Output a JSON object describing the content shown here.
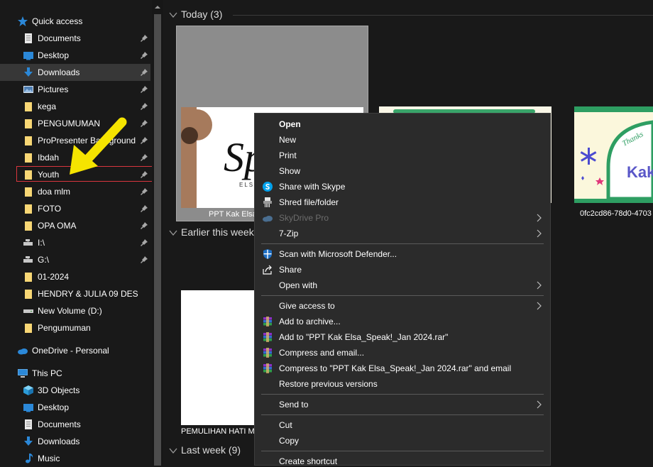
{
  "sidebar": {
    "quick_access": "Quick access",
    "items": [
      {
        "label": "Documents",
        "icon": "documents-icon"
      },
      {
        "label": "Desktop",
        "icon": "desktop-icon"
      },
      {
        "label": "Downloads",
        "icon": "downloads-icon"
      },
      {
        "label": "Pictures",
        "icon": "pictures-icon"
      },
      {
        "label": "kega",
        "icon": "folder-icon"
      },
      {
        "label": "PENGUMUMAN",
        "icon": "folder-icon"
      },
      {
        "label": "ProPresenter Background",
        "icon": "folder-icon"
      },
      {
        "label": "Ibdah",
        "icon": "folder-icon"
      },
      {
        "label": "Youth",
        "icon": "folder-icon"
      },
      {
        "label": "doa mlm",
        "icon": "folder-icon"
      },
      {
        "label": "FOTO",
        "icon": "folder-icon"
      },
      {
        "label": "OPA OMA",
        "icon": "folder-icon"
      },
      {
        "label": "I:\\",
        "icon": "network-drive-icon"
      },
      {
        "label": "G:\\",
        "icon": "network-drive-icon"
      },
      {
        "label": "01-2024",
        "icon": "folder-icon"
      },
      {
        "label": "HENDRY & JULIA 09 DES",
        "icon": "folder-icon"
      },
      {
        "label": "New Volume (D:)",
        "icon": "drive-icon"
      },
      {
        "label": "Pengumuman",
        "icon": "folder-icon"
      }
    ],
    "onedrive": "OneDrive - Personal",
    "this_pc": "This PC",
    "pc_items": [
      {
        "label": "3D Objects",
        "icon": "3d-objects-icon"
      },
      {
        "label": "Desktop",
        "icon": "desktop-icon"
      },
      {
        "label": "Documents",
        "icon": "documents-icon"
      },
      {
        "label": "Downloads",
        "icon": "downloads-icon"
      },
      {
        "label": "Music",
        "icon": "music-icon"
      }
    ]
  },
  "groups": {
    "today": "Today (3)",
    "earlier": "Earlier this week",
    "last_week": "Last week (9)"
  },
  "files": {
    "file1": "PPT Kak Elsa",
    "file2": "",
    "file3": "0fc2cd86-78d0-4703",
    "file4": "PEMULIHAN HATI M"
  },
  "thumb_text": {
    "elsa_sig": "Sp",
    "elsa_sub": "ELSA",
    "thanks": "Thanks",
    "kak": "Kak"
  },
  "context_menu": {
    "open": "Open",
    "new": "New",
    "print": "Print",
    "show": "Show",
    "share_skype": "Share with Skype",
    "shred": "Shred file/folder",
    "skydrive": "SkyDrive Pro",
    "zip": "7-Zip",
    "defender": "Scan with Microsoft Defender...",
    "share": "Share",
    "open_with": "Open with",
    "give_access": "Give access to",
    "add_archive": "Add to archive...",
    "add_rar": "Add to \"PPT Kak Elsa_Speak!_Jan 2024.rar\"",
    "compress_email": "Compress and email...",
    "compress_rar_email": "Compress to \"PPT Kak Elsa_Speak!_Jan 2024.rar\" and email",
    "restore": "Restore previous versions",
    "send_to": "Send to",
    "cut": "Cut",
    "copy": "Copy",
    "create_shortcut": "Create shortcut"
  },
  "colors": {
    "background": "#191919",
    "menu_bg": "#2b2b2b",
    "selected_bg": "#373737",
    "folder": "#f8d775",
    "accent_blue": "#2b88d8",
    "highlight_border": "#d9363e",
    "arrow_yellow": "#f5e400"
  }
}
